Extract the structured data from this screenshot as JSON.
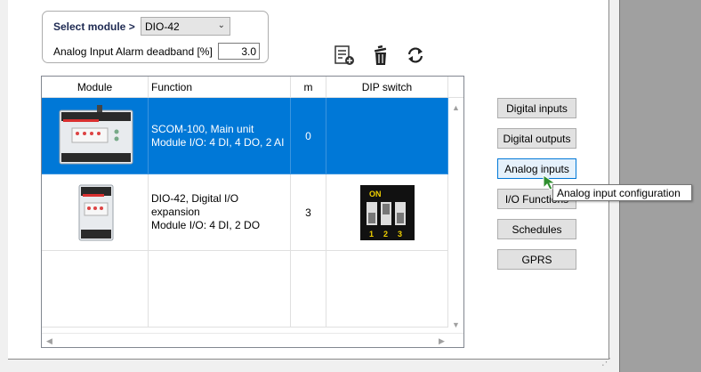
{
  "module_selector": {
    "label": "Select module >",
    "selected": "DIO-42",
    "deadband_label": "Analog Input Alarm deadband [%]",
    "deadband_value": "3.0"
  },
  "toolbar": {
    "icons": [
      "add-list-icon",
      "delete-bin-icon",
      "refresh-icon"
    ]
  },
  "grid": {
    "columns": [
      "Module",
      "Function",
      "m",
      "DIP switch"
    ],
    "rows": [
      {
        "image": "scom-100-device-image",
        "function_line1": "SCOM-100, Main unit",
        "function_line2": "Module I/O: 4 DI, 4 DO, 2 AI",
        "m": "0",
        "selected": true
      },
      {
        "image": "dio-42-device-image",
        "function_line1": "DIO-42, Digital I/O expansion",
        "function_line2": "Module I/O: 4 DI, 2 DO",
        "m": "3",
        "dip": {
          "on_label": "ON",
          "numbers": [
            "1",
            "2",
            "3"
          ]
        },
        "selected": false
      }
    ]
  },
  "buttons": {
    "digital_inputs": "Digital inputs",
    "digital_outputs": "Digital outputs",
    "analog_inputs": "Analog inputs",
    "io_functions": "I/O Functions",
    "schedules": "Schedules",
    "gprs": "GPRS"
  },
  "tooltip": "Analog input configuration",
  "colors": {
    "selection": "#0078d7",
    "label_navy": "#1e2a52",
    "cursor_green": "#2f8f2f"
  }
}
